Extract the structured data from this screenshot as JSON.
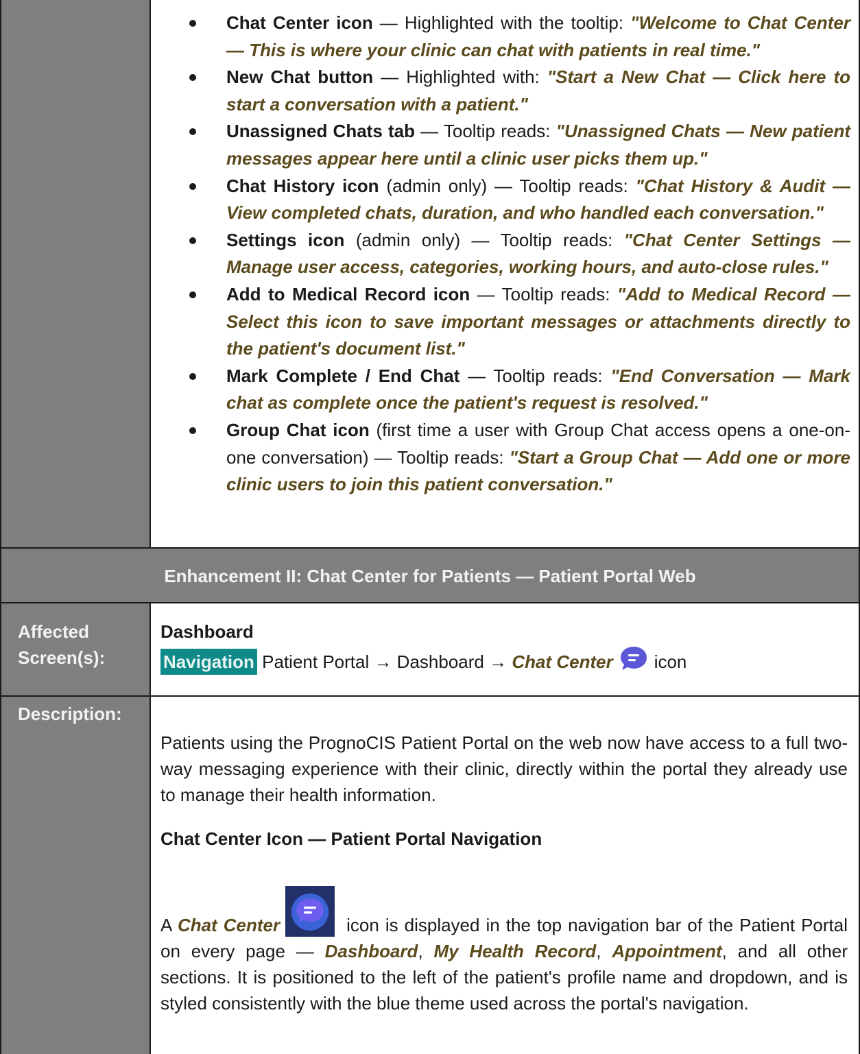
{
  "bullets": [
    {
      "title": "Chat Center icon",
      "paren": "",
      "mid": " — Highlighted with the tooltip: ",
      "quote": "\"Welcome to Chat Center — This is where your clinic can chat with patients in real time.\""
    },
    {
      "title": "New Chat button",
      "paren": "",
      "mid": " — Highlighted with: ",
      "quote": "\"Start a New Chat — Click here to start a conversation with a patient.\""
    },
    {
      "title": "Unassigned Chats tab",
      "paren": "",
      "mid": " — Tooltip reads: ",
      "quote": "\"Unassigned Chats — New patient messages appear here until a clinic user picks them up.\""
    },
    {
      "title": "Chat History icon",
      "paren": " (admin only)",
      "mid": " — Tooltip reads: ",
      "quote": "\"Chat History & Audit — View completed chats, duration, and who handled each conversation.\""
    },
    {
      "title": "Settings icon",
      "paren": " (admin only)",
      "mid": " — Tooltip reads: ",
      "quote": "\"Chat Center Settings — Manage user access, categories, working hours, and auto-close rules.\""
    },
    {
      "title": "Add to Medical Record icon",
      "paren": "",
      "mid": " — Tooltip reads: ",
      "quote": "\"Add to Medical Record — Select this icon to save important messages or attachments directly to the patient's document list.\""
    },
    {
      "title": "Mark Complete / End Chat",
      "paren": "",
      "mid": " — Tooltip reads: ",
      "quote": "\"End Conversation — Mark chat as complete once the patient's request is resolved.\""
    },
    {
      "title": "Group Chat icon",
      "paren": " (first time a user with Group Chat access opens a one-on-one conversation)",
      "mid": " — Tooltip reads: ",
      "quote": "\"Start a Group Chat — Add one or more clinic users to join this patient conversation.\""
    }
  ],
  "section_heading": "Enhancement II: Chat Center for Patients — Patient Portal Web",
  "affected": {
    "label_line1": "Affected",
    "label_line2": "Screen(s):",
    "screen_name": "Dashboard",
    "nav_badge": "Navigation",
    "nav_path": " Patient Portal → Dashboard → ",
    "nav_target": "Chat Center",
    "nav_suffix": "icon"
  },
  "description": {
    "label": "Description:",
    "intro": "Patients using the PrognoCIS Patient Portal on the web now have access to a full two-way messaging experience with their clinic, directly within the portal they already use to manage their health information.",
    "subheading": "Chat Center Icon — Patient Portal Navigation",
    "p2_a": "A ",
    "p2_b": "Chat Center",
    "p2_c": " icon is displayed in the top navigation bar of the Patient Portal on every page — ",
    "p2_d": "Dashboard",
    "p2_e": ", ",
    "p2_f": "My Health Record",
    "p2_g": ", ",
    "p2_h": "Appointment",
    "p2_i": ", and all other sections. It is positioned to the left of the patient's profile name and dropdown, and is styled consistently with the blue theme used across the portal's navigation."
  },
  "colors": {
    "label_bg": "#7f7f7f",
    "tooltip_text": "#5b4a1c",
    "nav_badge_bg": "#0e8a88",
    "chat_icon": "#5b57d6"
  }
}
